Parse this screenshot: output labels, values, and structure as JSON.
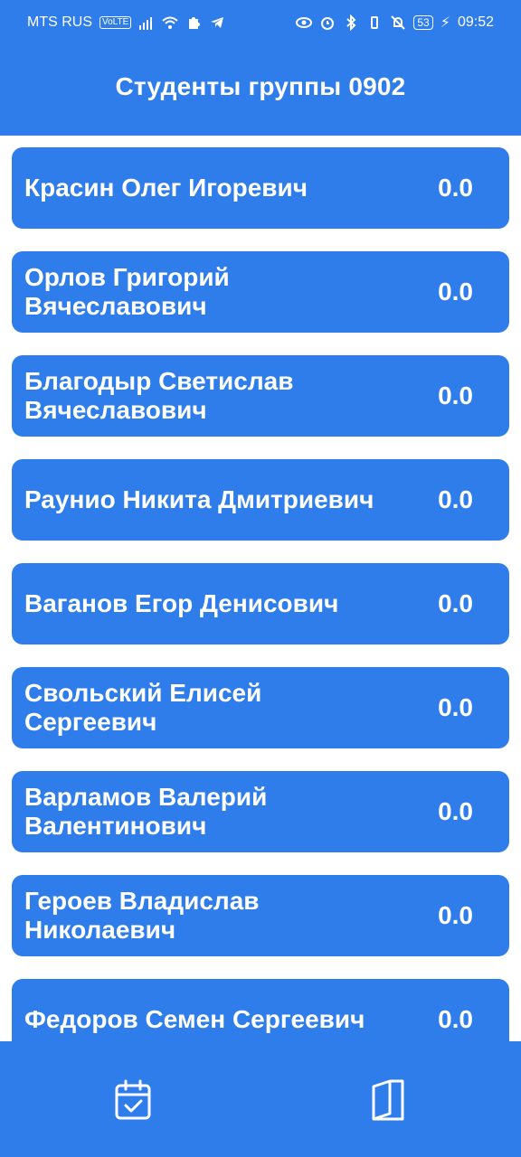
{
  "status_bar": {
    "carrier": "MTS RUS",
    "volte": "VoLTE",
    "battery": "53",
    "time": "09:52"
  },
  "header": {
    "title": "Студенты группы 0902"
  },
  "students": [
    {
      "name": "Красин Олег Игоревич",
      "score": "0.0"
    },
    {
      "name": "Орлов Григорий Вячеславович",
      "score": "0.0"
    },
    {
      "name": "Благодыр Светислав Вячеславович",
      "score": "0.0"
    },
    {
      "name": "Раунио Никита Дмитриевич",
      "score": "0.0"
    },
    {
      "name": "Ваганов Егор Денисович",
      "score": "0.0"
    },
    {
      "name": "Свольский Елисей Сергеевич",
      "score": "0.0"
    },
    {
      "name": "Варламов Валерий Валентинович",
      "score": "0.0"
    },
    {
      "name": "Героев Владислав Николаевич",
      "score": "0.0"
    },
    {
      "name": "Федоров Семен Сергеевич",
      "score": "0.0"
    }
  ],
  "bottom_nav": {
    "items": [
      {
        "icon": "calendar-check-icon"
      },
      {
        "icon": "book-icon"
      }
    ]
  },
  "colors": {
    "accent": "#2F7DEB",
    "background": "#FFFFFF",
    "text": "#FFFFFF"
  }
}
